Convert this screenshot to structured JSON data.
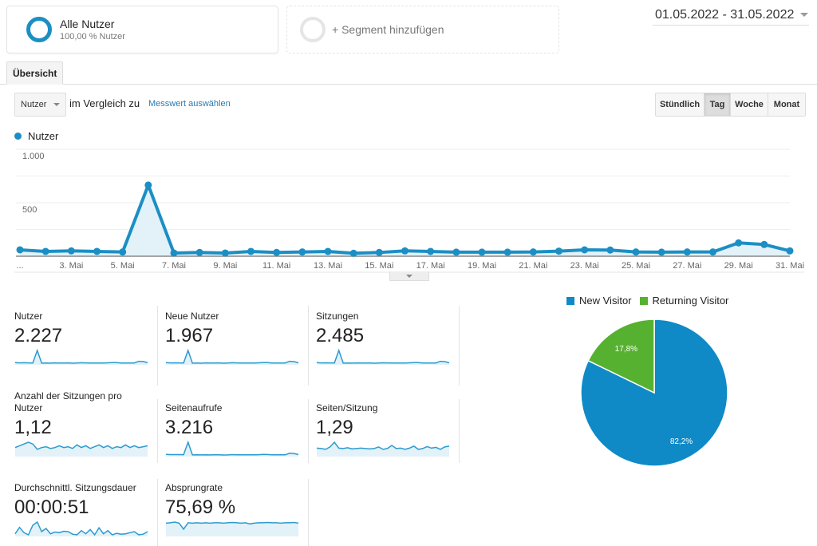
{
  "segments": {
    "all": {
      "title": "Alle Nutzer",
      "subtitle": "100,00 % Nutzer"
    },
    "add_label": "+ Segment hinzufügen"
  },
  "date_range": "01.05.2022 - 31.05.2022",
  "tabs": [
    {
      "label": "Übersicht",
      "active": true
    }
  ],
  "controls": {
    "metric_select": "Nutzer",
    "compare_label": "im Vergleich zu",
    "compare_link": "Messwert auswählen",
    "periods": [
      {
        "label": "Stündlich",
        "active": false
      },
      {
        "label": "Tag",
        "active": true
      },
      {
        "label": "Woche",
        "active": false
      },
      {
        "label": "Monat",
        "active": false
      }
    ]
  },
  "colors": {
    "primary": "#1b8fc4",
    "area_fill": "#e3f1f8",
    "new_visitor": "#0f8ac6",
    "returning_visitor": "#56b130"
  },
  "chart_data": [
    {
      "type": "line",
      "title": "",
      "legend": [
        "Nutzer"
      ],
      "xlabel": "",
      "ylabel": "",
      "ylim": [
        0,
        1000
      ],
      "y_ticks": [
        "500",
        "1.000"
      ],
      "y_tick_values": [
        500,
        1000
      ],
      "grid": true,
      "x": [
        "1. Mai",
        "2. Mai",
        "3. Mai",
        "4. Mai",
        "5. Mai",
        "6. Mai",
        "7. Mai",
        "8. Mai",
        "9. Mai",
        "10. Mai",
        "11. Mai",
        "12. Mai",
        "13. Mai",
        "14. Mai",
        "15. Mai",
        "16. Mai",
        "17. Mai",
        "18. Mai",
        "19. Mai",
        "20. Mai",
        "21. Mai",
        "22. Mai",
        "23. Mai",
        "24. Mai",
        "25. Mai",
        "26. Mai",
        "27. Mai",
        "28. Mai",
        "29. Mai",
        "30. Mai",
        "31. Mai"
      ],
      "x_tick_labels": [
        "...",
        "3. Mai",
        "5. Mai",
        "7. Mai",
        "9. Mai",
        "11. Mai",
        "13. Mai",
        "15. Mai",
        "17. Mai",
        "19. Mai",
        "21. Mai",
        "23. Mai",
        "25. Mai",
        "27. Mai",
        "29. Mai",
        "31. Mai"
      ],
      "series": [
        {
          "name": "Nutzer",
          "values": [
            60,
            45,
            50,
            45,
            40,
            665,
            30,
            35,
            30,
            45,
            35,
            40,
            45,
            28,
            35,
            50,
            45,
            38,
            38,
            38,
            40,
            48,
            60,
            58,
            40,
            38,
            40,
            40,
            125,
            110,
            50
          ]
        }
      ]
    },
    {
      "type": "pie",
      "legend": [
        "New Visitor",
        "Returning Visitor"
      ],
      "legend_position": "top",
      "slices": [
        {
          "name": "New Visitor",
          "value": 82.2,
          "label": "82,2%"
        },
        {
          "name": "Returning Visitor",
          "value": 17.8,
          "label": "17,8%"
        }
      ]
    }
  ],
  "metrics": [
    {
      "label": "Nutzer",
      "value": "2.227",
      "spark": [
        60,
        45,
        50,
        45,
        40,
        665,
        30,
        35,
        30,
        45,
        35,
        40,
        45,
        28,
        35,
        50,
        45,
        38,
        38,
        38,
        40,
        48,
        60,
        58,
        40,
        38,
        40,
        40,
        125,
        110,
        50
      ],
      "spark_min": 0
    },
    {
      "label": "Neue Nutzer",
      "value": "1.967",
      "spark": [
        50,
        38,
        42,
        38,
        34,
        600,
        25,
        30,
        25,
        40,
        30,
        35,
        40,
        24,
        30,
        44,
        40,
        33,
        33,
        33,
        35,
        42,
        52,
        50,
        35,
        33,
        35,
        35,
        110,
        95,
        42
      ],
      "spark_min": 0
    },
    {
      "label": "Sitzungen",
      "value": "2.485",
      "spark": [
        65,
        50,
        55,
        50,
        45,
        720,
        35,
        40,
        35,
        50,
        40,
        45,
        50,
        32,
        40,
        55,
        50,
        42,
        42,
        42,
        45,
        52,
        65,
        62,
        45,
        42,
        45,
        45,
        135,
        120,
        55
      ],
      "spark_min": 0
    },
    {
      "label": "Anzahl der Sitzungen pro Nutzer",
      "value": "1,12",
      "spark": [
        1.1,
        1.12,
        1.14,
        1.16,
        1.14,
        1.08,
        1.1,
        1.11,
        1.09,
        1.1,
        1.12,
        1.1,
        1.11,
        1.09,
        1.13,
        1.1,
        1.12,
        1.09,
        1.11,
        1.13,
        1.1,
        1.12,
        1.09,
        1.11,
        1.1,
        1.13,
        1.1,
        1.12,
        1.1,
        1.11,
        1.12
      ],
      "spark_min": 0
    },
    {
      "label": "Seitenaufrufe",
      "value": "3.216",
      "spark": [
        80,
        70,
        72,
        70,
        65,
        900,
        50,
        55,
        50,
        62,
        52,
        58,
        62,
        45,
        52,
        70,
        62,
        55,
        55,
        55,
        58,
        66,
        80,
        78,
        58,
        55,
        58,
        58,
        165,
        145,
        70
      ],
      "spark_min": 0
    },
    {
      "label": "Seiten/Sitzung",
      "value": "1,29",
      "spark": [
        1.25,
        1.24,
        1.22,
        1.28,
        1.4,
        1.25,
        1.24,
        1.26,
        1.23,
        1.24,
        1.25,
        1.24,
        1.23,
        1.24,
        1.28,
        1.22,
        1.24,
        1.32,
        1.24,
        1.25,
        1.22,
        1.25,
        1.3,
        1.22,
        1.24,
        1.29,
        1.25,
        1.27,
        1.22,
        1.28,
        1.3
      ],
      "spark_min": 0
    },
    {
      "label": "Durchschnittl. Sitzungsdauer",
      "value": "00:00:51",
      "spark": [
        40,
        70,
        45,
        35,
        80,
        95,
        50,
        65,
        40,
        48,
        45,
        52,
        50,
        38,
        35,
        55,
        40,
        60,
        35,
        68,
        40,
        55,
        35,
        42,
        38,
        40,
        45,
        50,
        35,
        38,
        50
      ],
      "spark_min": 0
    },
    {
      "label": "Absprungrate",
      "value": "75,69 %",
      "spark": [
        76,
        77,
        79,
        76,
        60,
        77,
        76,
        77,
        76,
        77,
        76,
        77,
        77,
        76,
        77,
        78,
        77,
        76,
        77,
        74,
        76,
        77,
        77,
        78,
        77,
        77,
        76,
        77,
        77,
        78,
        76
      ],
      "spark_min": 0
    }
  ]
}
